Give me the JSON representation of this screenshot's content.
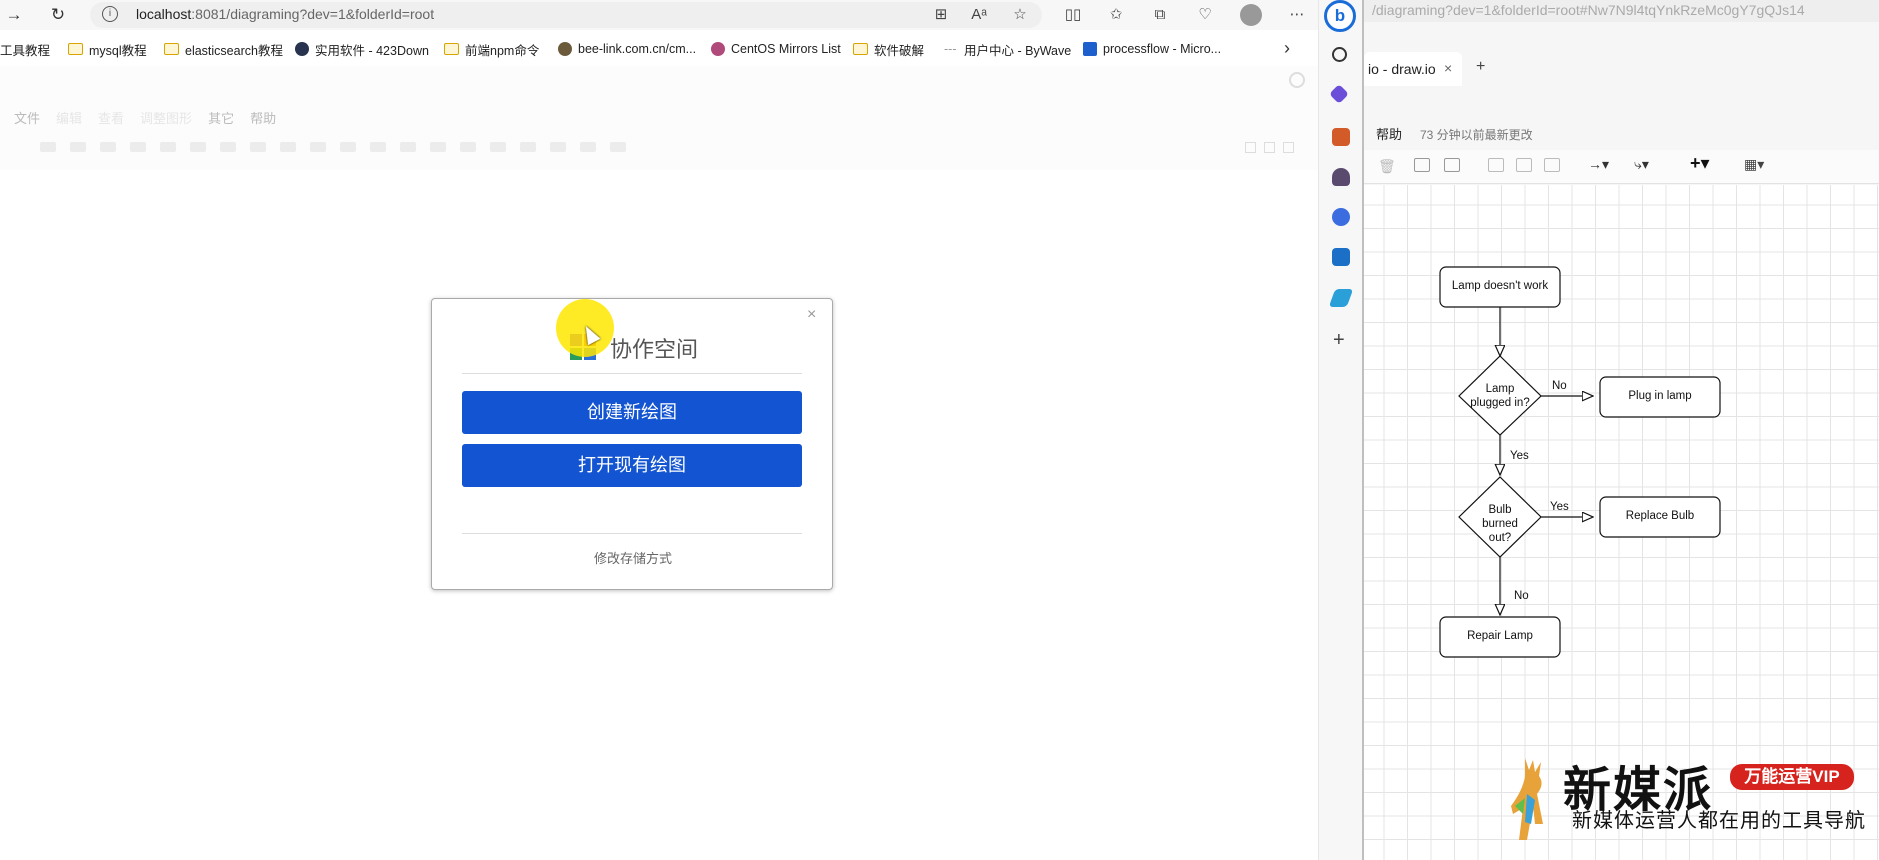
{
  "browser": {
    "url_host": "localhost",
    "url_rest": ":8081/diagraming?dev=1&folderId=root"
  },
  "bookmarks": [
    {
      "label": "工具教程",
      "icon": "folder-icon"
    },
    {
      "label": "mysql教程",
      "icon": "folder-icon"
    },
    {
      "label": "elasticsearch教程",
      "icon": "folder-icon"
    },
    {
      "label": "实用软件 - 423Down",
      "icon": "site-icon"
    },
    {
      "label": "前端npm命令",
      "icon": "folder-icon"
    },
    {
      "label": "bee-link.com.cn/cm...",
      "icon": "site-icon"
    },
    {
      "label": "CentOS Mirrors List",
      "icon": "site-icon"
    },
    {
      "label": "软件破解",
      "icon": "folder-icon"
    },
    {
      "label": "用户中心 - ByWave",
      "icon": "site-icon"
    },
    {
      "label": "processflow - Micro...",
      "icon": "azure-icon"
    }
  ],
  "ghost_menu": [
    "文件",
    "编辑",
    "查看",
    "调整图形",
    "其它",
    "帮助"
  ],
  "dialog": {
    "title": "协作空间",
    "create_label": "创建新绘图",
    "open_label": "打开现有绘图",
    "storage_label": "修改存储方式",
    "close": "×"
  },
  "right": {
    "url": "/diagraming?dev=1&folderId=root#Nw7N9l4tqYnkRzeMc0gY7gQJs14",
    "tab_title": "io - draw.io",
    "tab_close": "×",
    "new_tab": "+",
    "menu_help": "帮助",
    "last_change": "73 分钟以前最新更改",
    "flow": {
      "n1": "Lamp doesn't work",
      "n2": "Lamp plugged in?",
      "n3": "Plug in lamp",
      "n4": "Bulb burned out?",
      "n5": "Replace Bulb",
      "n6": "Repair Lamp",
      "e_no1": "No",
      "e_yes1": "Yes",
      "e_yes2": "Yes",
      "e_no2": "No"
    }
  },
  "watermark": {
    "big": "新媒派",
    "vip": "万能运营VIP",
    "sub": "新媒体运营人都在用的工具导航"
  },
  "colors": {
    "primary": "#1254d1",
    "highlight": "#ffe600",
    "watermark_red": "#d7231e"
  }
}
